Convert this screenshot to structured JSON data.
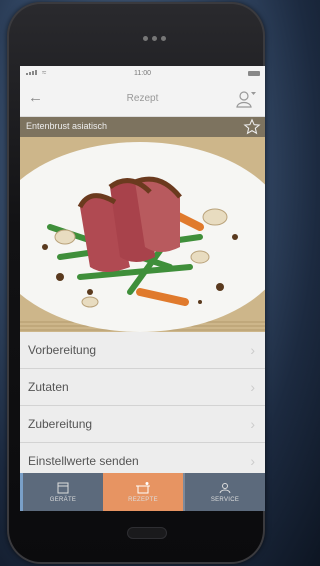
{
  "statusbar": {
    "time": "11:00"
  },
  "appbar": {
    "title": "Rezept"
  },
  "hero": {
    "title": "Entenbrust asiatisch"
  },
  "menu": {
    "items": [
      {
        "label": "Vorbereitung"
      },
      {
        "label": "Zutaten"
      },
      {
        "label": "Zubereitung"
      },
      {
        "label": "Einstellwerte senden"
      }
    ]
  },
  "tabs": [
    {
      "label": "GERÄTE",
      "icon": "appliance-icon"
    },
    {
      "label": "REZEPTE",
      "icon": "pot-icon",
      "active": true
    },
    {
      "label": "SERVICE",
      "icon": "service-user-icon"
    }
  ],
  "colors": {
    "active_tab": "#e79462",
    "tab_bg": "#5c6a7c",
    "screen_bg": "#ececec"
  }
}
